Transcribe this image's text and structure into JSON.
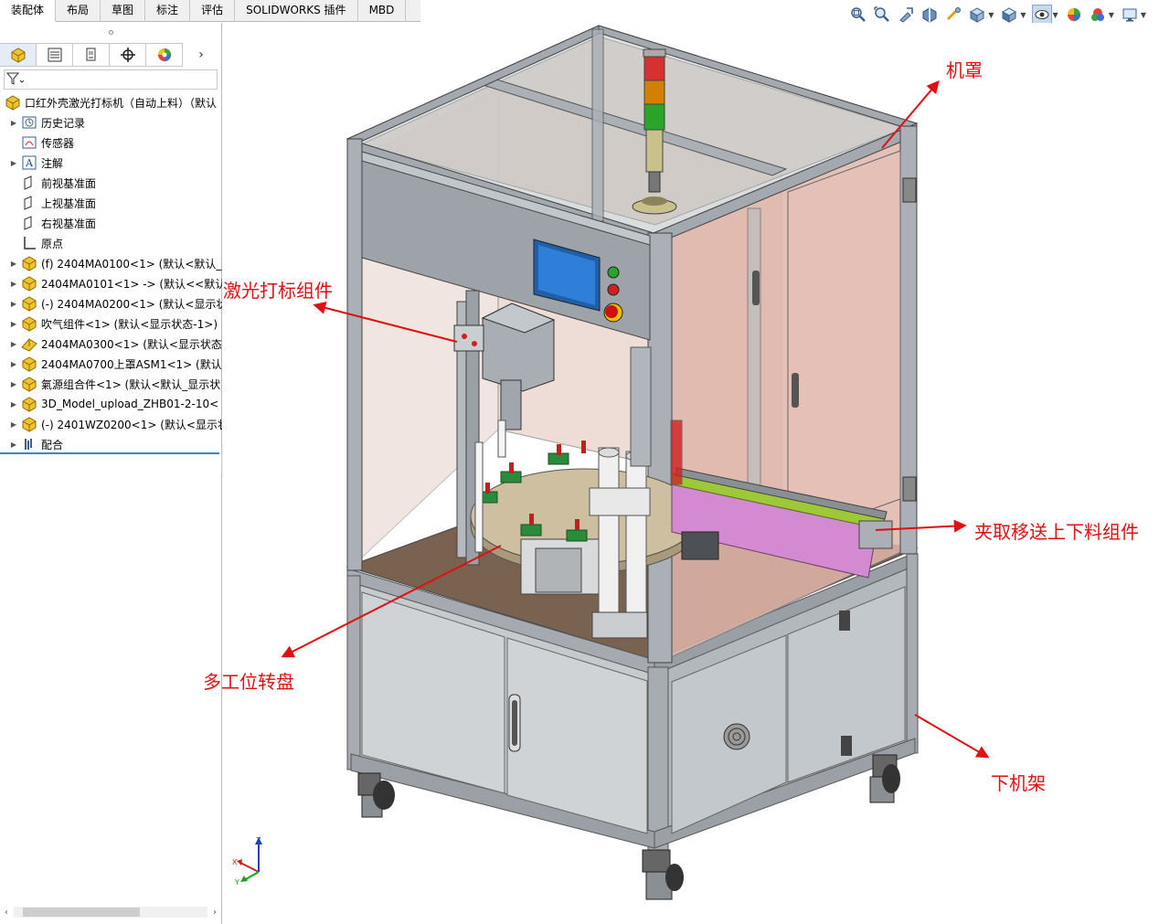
{
  "tabs": [
    {
      "label": "装配体",
      "active": true
    },
    {
      "label": "布局",
      "active": false
    },
    {
      "label": "草图",
      "active": false
    },
    {
      "label": "标注",
      "active": false
    },
    {
      "label": "评估",
      "active": false
    },
    {
      "label": "SOLIDWORKS 插件",
      "active": false
    },
    {
      "label": "MBD",
      "active": false
    }
  ],
  "view_toolbar": [
    "zoom-to-fit-icon",
    "zoom-area-icon",
    "previous-view-icon",
    "section-view-icon",
    "dynamic-annotation-icon",
    "view-orientation-icon",
    "display-style-icon",
    "hide-show-icon",
    "edit-appearance-icon",
    "apply-scene-icon",
    "view-settings-icon"
  ],
  "panel_tabs": [
    "feature-manager-icon",
    "property-manager-icon",
    "configuration-manager-icon",
    "dimxpert-icon",
    "display-manager-icon"
  ],
  "tree": {
    "root": "口红外壳激光打标机（自动上料）（默认",
    "items": [
      {
        "label": "历史记录",
        "icon": "history-folder-icon",
        "expandable": true
      },
      {
        "label": "传感器",
        "icon": "sensor-icon",
        "expandable": false
      },
      {
        "label": "注解",
        "icon": "annotation-icon",
        "expandable": true
      },
      {
        "label": "前视基准面",
        "icon": "plane-icon",
        "expandable": false
      },
      {
        "label": "上视基准面",
        "icon": "plane-icon",
        "expandable": false
      },
      {
        "label": "右视基准面",
        "icon": "plane-icon",
        "expandable": false
      },
      {
        "label": "原点",
        "icon": "origin-icon",
        "expandable": false
      },
      {
        "label": "(f) 2404MA0100<1> (默认<默认_显",
        "icon": "assembly-icon",
        "expandable": true
      },
      {
        "label": "2404MA0101<1> -> (默认<<默认",
        "icon": "assembly-icon",
        "expandable": true
      },
      {
        "label": "(-) 2404MA0200<1> (默认<显示状",
        "icon": "assembly-icon",
        "expandable": true
      },
      {
        "label": "吹气组件<1> (默认<显示状态-1>)",
        "icon": "assembly-icon",
        "expandable": true
      },
      {
        "label": "2404MA0300<1> (默认<显示状态",
        "icon": "part-icon",
        "expandable": true
      },
      {
        "label": "2404MA0700上罩ASM1<1> (默认",
        "icon": "assembly-icon",
        "expandable": true
      },
      {
        "label": "氣源组合件<1> (默认<默认_显示状",
        "icon": "assembly-icon",
        "expandable": true
      },
      {
        "label": "3D_Model_upload_ZHB01-2-10<",
        "icon": "assembly-icon",
        "expandable": true
      },
      {
        "label": "(-) 2401WZ0200<1> (默认<显示状",
        "icon": "assembly-icon",
        "expandable": true
      },
      {
        "label": "配合",
        "icon": "mates-icon",
        "expandable": true
      }
    ]
  },
  "callouts": {
    "cover": "机罩",
    "laser": "激光打标组件",
    "transfer": "夹取移送上下料组件",
    "turntable": "多工位转盘",
    "frame": "下机架"
  },
  "colors": {
    "callout": "#e01010",
    "frame_steel": "#9aa0a8",
    "glass_tint": "#e7c6bc",
    "screen_blue": "#2f7fd8",
    "selection_blue": "#3b87c4"
  },
  "triad": {
    "x": "X",
    "y": "Y",
    "z": "Z"
  }
}
